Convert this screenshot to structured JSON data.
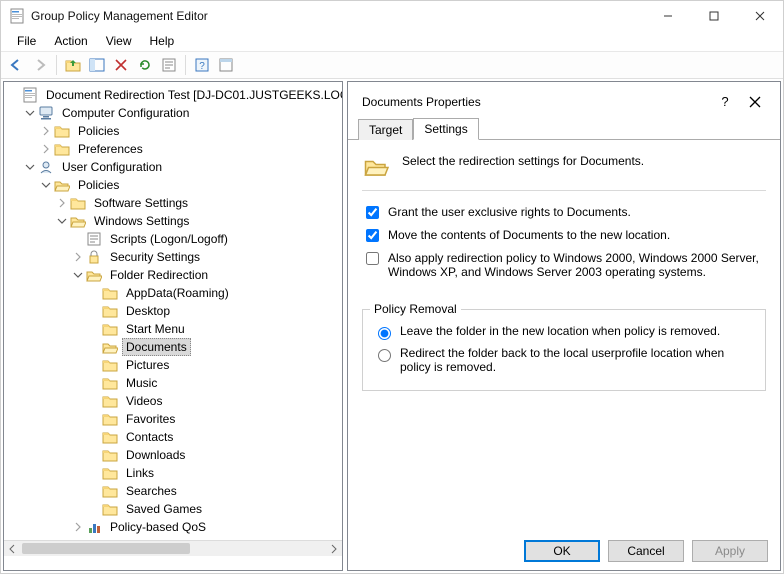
{
  "window": {
    "title": "Group Policy Management Editor"
  },
  "menus": {
    "file": "File",
    "action": "Action",
    "view": "View",
    "help": "Help"
  },
  "tree": {
    "root": "Document Redirection Test [DJ-DC01.JUSTGEEKS.LOC",
    "comp": "Computer Configuration",
    "comp_policies": "Policies",
    "comp_prefs": "Preferences",
    "user": "User Configuration",
    "user_policies": "Policies",
    "softset": "Software Settings",
    "winset": "Windows Settings",
    "scripts": "Scripts (Logon/Logoff)",
    "secset": "Security Settings",
    "folderredir": "Folder Redirection",
    "items": {
      "appdata": "AppData(Roaming)",
      "desktop": "Desktop",
      "startmenu": "Start Menu",
      "documents": "Documents",
      "pictures": "Pictures",
      "music": "Music",
      "videos": "Videos",
      "favorites": "Favorites",
      "contacts": "Contacts",
      "downloads": "Downloads",
      "links": "Links",
      "searches": "Searches",
      "savedgames": "Saved Games"
    },
    "pbqos": "Policy-based QoS"
  },
  "props": {
    "title": "Documents Properties",
    "tabs": {
      "target": "Target",
      "settings": "Settings"
    },
    "header": "Select the redirection settings for Documents.",
    "cb1": "Grant the user exclusive rights to Documents.",
    "cb2": "Move the contents of Documents to the new location.",
    "cb3": "Also apply redirection policy to Windows 2000, Windows 2000 Server, Windows XP, and Windows Server 2003 operating systems.",
    "fs_title": "Policy Removal",
    "r1": "Leave the folder in the new location when policy is removed.",
    "r2": "Redirect the folder back to the local userprofile location when policy is removed.",
    "ok": "OK",
    "cancel": "Cancel",
    "apply": "Apply"
  }
}
